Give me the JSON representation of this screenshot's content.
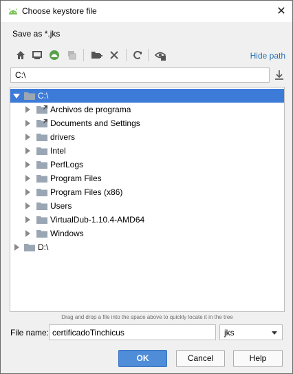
{
  "window": {
    "title": "Choose keystore file",
    "close_glyph": "✕"
  },
  "dialog": {
    "subtitle": "Save as *.jks"
  },
  "toolbar": {
    "buttons": [
      "home-icon",
      "desktop-icon",
      "project-icon",
      "module-icon",
      "new-folder-icon",
      "delete-icon",
      "refresh-icon",
      "show-hidden-icon"
    ],
    "hide_path_label": "Hide path"
  },
  "path": {
    "value": "C:\\"
  },
  "tree": {
    "root_c": "C:\\",
    "children": [
      "Archivos de programa",
      "Documents and Settings",
      "drivers",
      "Intel",
      "PerfLogs",
      "Program Files",
      "Program Files (x86)",
      "Users",
      "VirtualDub-1.10.4-AMD64",
      "Windows"
    ],
    "root_d": "D:\\"
  },
  "hint": "Drag and drop a file into the space above to quickly locate it in the tree",
  "file_name": {
    "label": "File name:",
    "value": "certificadoTinchicus"
  },
  "extension": {
    "selected": "jks"
  },
  "buttons": {
    "ok": "OK",
    "cancel": "Cancel",
    "help": "Help"
  },
  "colors": {
    "selection": "#3d7bd8",
    "accent": "#4f8dd9",
    "link": "#2470b3"
  }
}
